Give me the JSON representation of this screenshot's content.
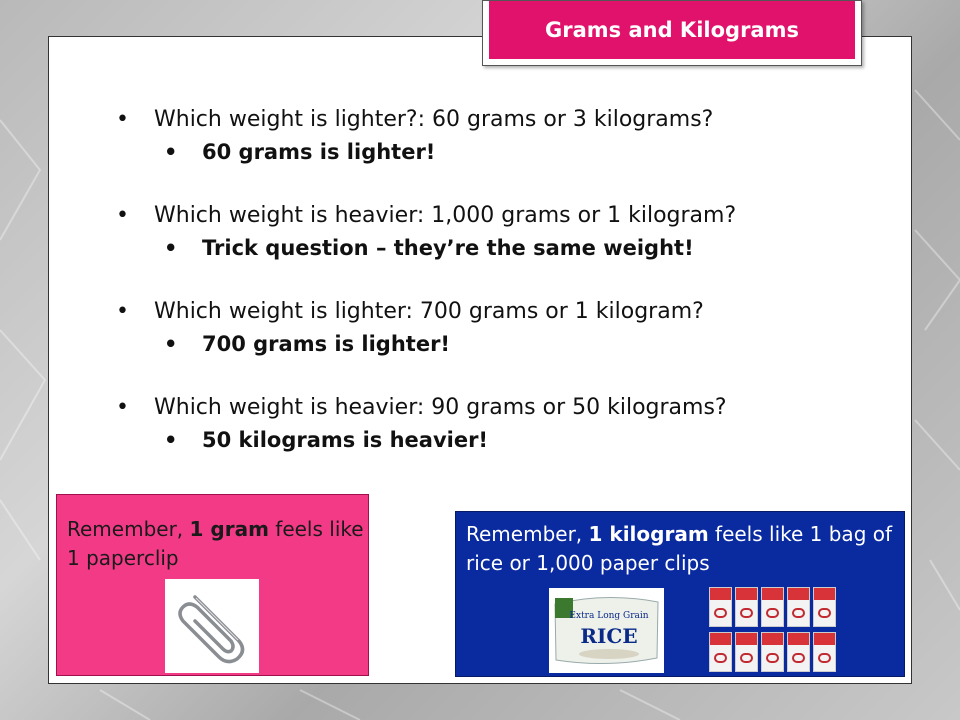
{
  "title": "Grams and Kilograms",
  "questions": [
    {
      "question": "Which weight is lighter?: 60 grams or 3 kilograms?",
      "answer": "60 grams is lighter!"
    },
    {
      "question": "Which weight is heavier: 1,000 grams or 1 kilogram?",
      "answer": "Trick question – they’re the same weight!"
    },
    {
      "question": "Which weight is lighter: 700 grams or 1 kilogram?",
      "answer": "700 grams is lighter!"
    },
    {
      "question": "Which weight is heavier: 90 grams or 50 kilograms?",
      "answer": "50 kilograms is heavier!"
    }
  ],
  "gram_note": {
    "prefix": "Remember, ",
    "bold": "1 gram",
    "suffix": " feels like 1 paperclip"
  },
  "kilogram_note": {
    "prefix": "Remember, ",
    "bold": "1 kilogram",
    "suffix": " feels like 1 bag of rice or 1,000 paper clips"
  },
  "rice_bag_text": {
    "brand": "Extra Long Grain",
    "name": "RICE"
  },
  "icons": [
    "paperclip-icon",
    "rice-bag-icon",
    "paperclip-box-icon"
  ],
  "colors": {
    "title_bg": "#e0126b",
    "gram_box_bg": "#f23a86",
    "kilogram_box_bg": "#0a2aa0"
  }
}
